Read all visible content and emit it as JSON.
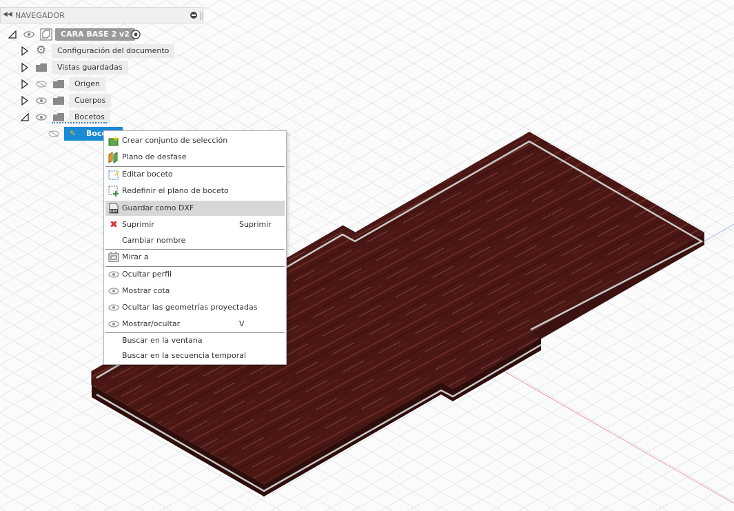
{
  "navigator": {
    "title": "NAVEGADOR",
    "root_label": "CARA BASE 2 v2",
    "items": [
      {
        "label": "Configuración del documento"
      },
      {
        "label": "Vistas guardadas"
      },
      {
        "label": "Origen"
      },
      {
        "label": "Cuerpos"
      },
      {
        "label": "Bocetos"
      }
    ],
    "selected_sketch_label": "Boceto"
  },
  "context_menu": {
    "items": [
      {
        "label": "Crear conjunto de selección",
        "icon": "selection-set-icon"
      },
      {
        "label": "Plano de desfase",
        "icon": "offset-plane-icon"
      },
      {
        "label": "Editar boceto",
        "icon": "edit-sketch-icon"
      },
      {
        "label": "Redefinir el plano de boceto",
        "icon": "redefine-plane-icon"
      },
      {
        "label": "Guardar como DXF",
        "icon": "dxf-file-icon"
      },
      {
        "label": "Suprimir",
        "shortcut": "Suprimir",
        "icon": "delete-x-icon"
      },
      {
        "label": "Cambiar nombre"
      },
      {
        "label": "Mirar a",
        "icon": "look-at-icon"
      },
      {
        "label": "Ocultar perfil",
        "icon": "eye-icon"
      },
      {
        "label": "Mostrar cota",
        "icon": "eye-icon"
      },
      {
        "label": "Ocultar las geometrías proyectadas",
        "icon": "eye-icon"
      },
      {
        "label": "Mostrar/ocultar",
        "shortcut": "V",
        "icon": "eye-icon"
      },
      {
        "label": "Buscar en la ventana"
      },
      {
        "label": "Buscar en la secuencia temporal"
      }
    ],
    "highlighted": "Guardar como DXF"
  },
  "colors": {
    "wood_dark": "#3d1310",
    "wood_mid": "#5a1e19",
    "selection_blue": "#1a8ad4",
    "grid": "#d9dde3"
  }
}
